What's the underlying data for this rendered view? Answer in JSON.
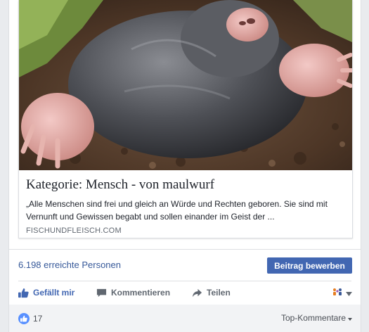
{
  "link_card": {
    "title": "Kategorie: Mensch - von maulwurf",
    "description": "„Alle Menschen sind frei und gleich an Würde und Rechten geboren. Sie sind mit Vernunft und Gewissen begabt und sollen einander im Geist der ...",
    "domain": "FISCHUNDFLEISCH.COM"
  },
  "insights": {
    "reach_text": "6.198 erreichte Personen",
    "promote_label": "Beitrag bewerben"
  },
  "actions": {
    "like_label": "Gefällt mir",
    "comment_label": "Kommentieren",
    "share_label": "Teilen"
  },
  "footer": {
    "like_count": "17",
    "sort_label": "Top-Kommentare"
  },
  "colors": {
    "brand_blue": "#4267b2",
    "link_blue": "#365899",
    "muted_text": "#606770"
  }
}
